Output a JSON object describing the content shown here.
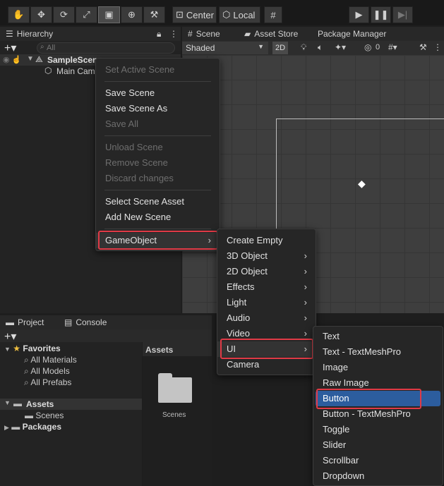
{
  "toolbar": {
    "tools": [
      "hand-icon",
      "move-icon",
      "rotate-icon",
      "scale-icon",
      "rect-icon",
      "transform-icon",
      "custom-tool-icon"
    ],
    "pivot_label": "Center",
    "space_label": "Local",
    "play_controls": [
      "play-icon",
      "pause-icon",
      "step-icon"
    ]
  },
  "hierarchy": {
    "tab_label": "Hierarchy",
    "search_placeholder": "All",
    "scene_name": "SampleScene",
    "child": "Main Camera"
  },
  "scene_view": {
    "tabs": [
      "Scene",
      "Asset Store",
      "Package Manager"
    ],
    "shading": "Shaded",
    "mode_2d": "2D",
    "gizmo_count": "0"
  },
  "project": {
    "tabs": [
      "Project",
      "Console"
    ],
    "favorites_label": "Favorites",
    "favorites": [
      "All Materials",
      "All Models",
      "All Prefabs"
    ],
    "assets_label": "Assets",
    "scenes_label": "Scenes",
    "packages_label": "Packages",
    "breadcrumb": "Assets",
    "folder_name": "Scenes"
  },
  "context_menu": {
    "items": [
      "Set Active Scene",
      "Save Scene",
      "Save Scene As",
      "Save All",
      "Unload Scene",
      "Remove Scene",
      "Discard changes",
      "Select Scene Asset",
      "Add New Scene",
      "GameObject"
    ]
  },
  "gameobject_menu": {
    "items": [
      "Create Empty",
      "3D Object",
      "2D Object",
      "Effects",
      "Light",
      "Audio",
      "Video",
      "UI",
      "Camera"
    ]
  },
  "ui_menu": {
    "items": [
      "Text",
      "Text - TextMeshPro",
      "Image",
      "Raw Image",
      "Button",
      "Button - TextMeshPro",
      "Toggle",
      "Slider",
      "Scrollbar",
      "Dropdown"
    ]
  },
  "colors": {
    "highlight": "#2c5d9e",
    "annotation": "#e03a46"
  }
}
